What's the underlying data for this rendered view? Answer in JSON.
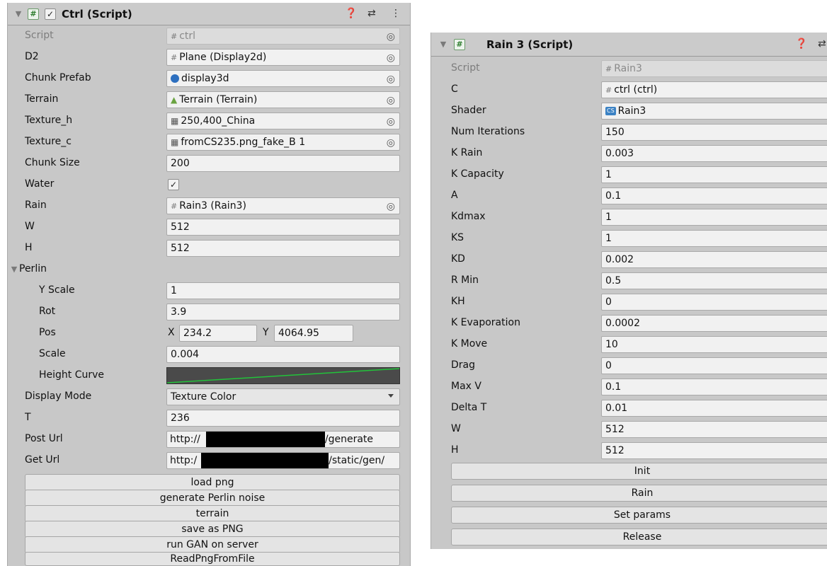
{
  "ctrl": {
    "title": "Ctrl (Script)",
    "rows": {
      "script": {
        "label": "Script",
        "value": "ctrl"
      },
      "d2": {
        "label": "D2",
        "value": "Plane (Display2d)"
      },
      "chunk_prefab": {
        "label": "Chunk Prefab",
        "value": "display3d"
      },
      "terrain": {
        "label": "Terrain",
        "value": "Terrain (Terrain)"
      },
      "texture_h": {
        "label": "Texture_h",
        "value": "250,400_China"
      },
      "texture_c": {
        "label": "Texture_c",
        "value": "fromCS235.png_fake_B 1"
      },
      "chunk_size": {
        "label": "Chunk Size",
        "value": "200"
      },
      "water": {
        "label": "Water",
        "value": "✓"
      },
      "rain": {
        "label": "Rain",
        "value": "Rain3 (Rain3)"
      },
      "w": {
        "label": "W",
        "value": "512"
      },
      "h": {
        "label": "H",
        "value": "512"
      },
      "perlin": {
        "label": "Perlin"
      },
      "y_scale": {
        "label": "Y Scale",
        "value": "1"
      },
      "rot": {
        "label": "Rot",
        "value": "3.9"
      },
      "pos": {
        "label": "Pos",
        "x_label": "X",
        "x_value": "234.2",
        "y_label": "Y",
        "y_value": "4064.95"
      },
      "scale": {
        "label": "Scale",
        "value": "0.004"
      },
      "height_curve": {
        "label": "Height Curve"
      },
      "display_mode": {
        "label": "Display Mode",
        "value": "Texture Color"
      },
      "t": {
        "label": "T",
        "value": "236"
      },
      "post_url": {
        "label": "Post Url",
        "value_start": "http://",
        "value_end": "/generate"
      },
      "get_url": {
        "label": "Get Url",
        "value_start": "http:/",
        "value_end": "/static/gen/"
      }
    },
    "buttons": [
      "load png",
      "generate Perlin noise",
      "terrain",
      "save as PNG",
      "run GAN on server",
      "ReadPngFromFile"
    ]
  },
  "rain3": {
    "title": "Rain 3 (Script)",
    "rows": {
      "script": {
        "label": "Script",
        "value": "Rain3"
      },
      "c": {
        "label": "C",
        "value": "ctrl (ctrl)"
      },
      "shader": {
        "label": "Shader",
        "value": "Rain3"
      },
      "num_iterations": {
        "label": "Num Iterations",
        "value": "150"
      },
      "k_rain": {
        "label": "K Rain",
        "value": "0.003"
      },
      "k_capacity": {
        "label": "K Capacity",
        "value": "1"
      },
      "a": {
        "label": "A",
        "value": "0.1"
      },
      "kdmax": {
        "label": "Kdmax",
        "value": "1"
      },
      "ks": {
        "label": "KS",
        "value": "1"
      },
      "kd": {
        "label": "KD",
        "value": "0.002"
      },
      "r_min": {
        "label": "R Min",
        "value": "0.5"
      },
      "kh": {
        "label": "KH",
        "value": "0"
      },
      "k_evaporation": {
        "label": "K Evaporation",
        "value": "0.0002"
      },
      "k_move": {
        "label": "K Move",
        "value": "10"
      },
      "drag": {
        "label": "Drag",
        "value": "0"
      },
      "max_v": {
        "label": "Max V",
        "value": "0.1"
      },
      "delta_t": {
        "label": "Delta T",
        "value": "0.01"
      },
      "w": {
        "label": "W",
        "value": "512"
      },
      "h": {
        "label": "H",
        "value": "512"
      }
    },
    "buttons": [
      "Init",
      "Rain",
      "Set params",
      "Release"
    ]
  },
  "icons": {
    "help": "help-icon",
    "settings": "sliders-icon",
    "menu": "kebab-menu-icon",
    "object_picker": "target-icon"
  },
  "colors": {
    "panel_bg": "#c8c8c8",
    "field_bg": "#f1f1f1",
    "curve_bg": "#4a4a4a",
    "curve_line": "#22c33a"
  }
}
